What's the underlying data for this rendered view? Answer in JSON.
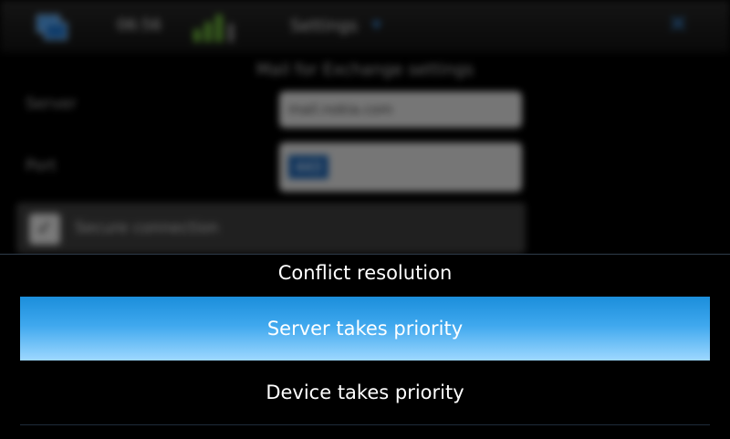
{
  "background": {
    "clock": "06:56",
    "app_title": "Settings",
    "page_heading": "Mail for Exchange settings",
    "server_label": "Server",
    "server_value": "mail.nokia.com",
    "port_label": "Port",
    "port_value": "443",
    "ssl_label": "Secure connection",
    "colors": {
      "accent": "#3a8bdc",
      "battery": "#6ab33a"
    }
  },
  "picker": {
    "title": "Conflict resolution",
    "options": [
      {
        "label": "Server takes priority",
        "selected": true
      },
      {
        "label": "Device takes priority",
        "selected": false
      }
    ],
    "colors": {
      "selected_top": "#1b8edb",
      "selected_bottom": "#9ed8ff"
    }
  }
}
